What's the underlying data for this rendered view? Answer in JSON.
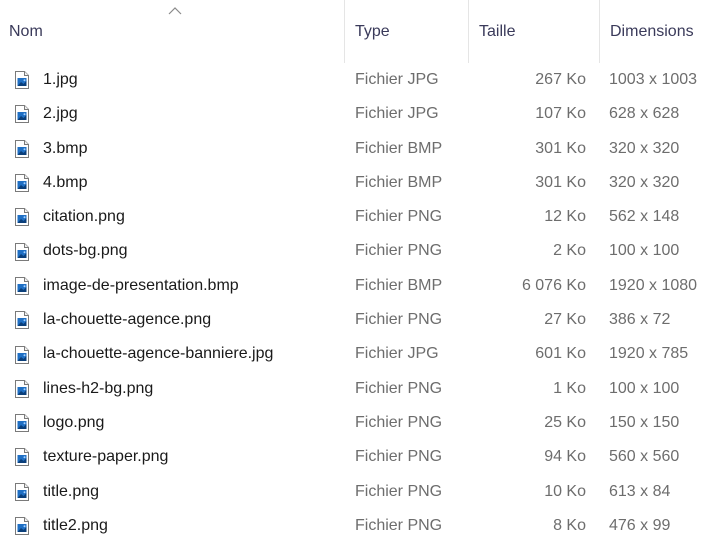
{
  "columns": {
    "name": "Nom",
    "type": "Type",
    "size": "Taille",
    "dimensions": "Dimensions"
  },
  "sort": {
    "column": "Nom",
    "direction": "ascending",
    "icon": "sort-up-chevron-icon"
  },
  "files": [
    {
      "name": "1.jpg",
      "type": "Fichier JPG",
      "size": "267 Ko",
      "dimensions": "1003 x 1003",
      "icon": "image-file-icon"
    },
    {
      "name": "2.jpg",
      "type": "Fichier JPG",
      "size": "107 Ko",
      "dimensions": "628 x 628",
      "icon": "image-file-icon"
    },
    {
      "name": "3.bmp",
      "type": "Fichier BMP",
      "size": "301 Ko",
      "dimensions": "320 x 320",
      "icon": "image-file-icon"
    },
    {
      "name": "4.bmp",
      "type": "Fichier BMP",
      "size": "301 Ko",
      "dimensions": "320 x 320",
      "icon": "image-file-icon"
    },
    {
      "name": "citation.png",
      "type": "Fichier PNG",
      "size": "12 Ko",
      "dimensions": "562 x 148",
      "icon": "image-file-icon"
    },
    {
      "name": "dots-bg.png",
      "type": "Fichier PNG",
      "size": "2 Ko",
      "dimensions": "100 x 100",
      "icon": "image-file-icon"
    },
    {
      "name": "image-de-presentation.bmp",
      "type": "Fichier BMP",
      "size": "6 076 Ko",
      "dimensions": "1920 x 1080",
      "icon": "image-file-icon"
    },
    {
      "name": "la-chouette-agence.png",
      "type": "Fichier PNG",
      "size": "27 Ko",
      "dimensions": "386 x 72",
      "icon": "image-file-icon"
    },
    {
      "name": "la-chouette-agence-banniere.jpg",
      "type": "Fichier JPG",
      "size": "601 Ko",
      "dimensions": "1920 x 785",
      "icon": "image-file-icon"
    },
    {
      "name": "lines-h2-bg.png",
      "type": "Fichier PNG",
      "size": "1 Ko",
      "dimensions": "100 x 100",
      "icon": "image-file-icon"
    },
    {
      "name": "logo.png",
      "type": "Fichier PNG",
      "size": "25 Ko",
      "dimensions": "150 x 150",
      "icon": "image-file-icon"
    },
    {
      "name": "texture-paper.png",
      "type": "Fichier PNG",
      "size": "94 Ko",
      "dimensions": "560 x 560",
      "icon": "image-file-icon"
    },
    {
      "name": "title.png",
      "type": "Fichier PNG",
      "size": "10 Ko",
      "dimensions": "613 x 84",
      "icon": "image-file-icon"
    },
    {
      "name": "title2.png",
      "type": "Fichier PNG",
      "size": "8 Ko",
      "dimensions": "476 x 99",
      "icon": "image-file-icon"
    }
  ],
  "colors": {
    "header_text": "#3a3a5a",
    "secondary_text": "#6d6d6d",
    "primary_text": "#1a1a1a",
    "icon_blue": "#1f6fc4"
  }
}
